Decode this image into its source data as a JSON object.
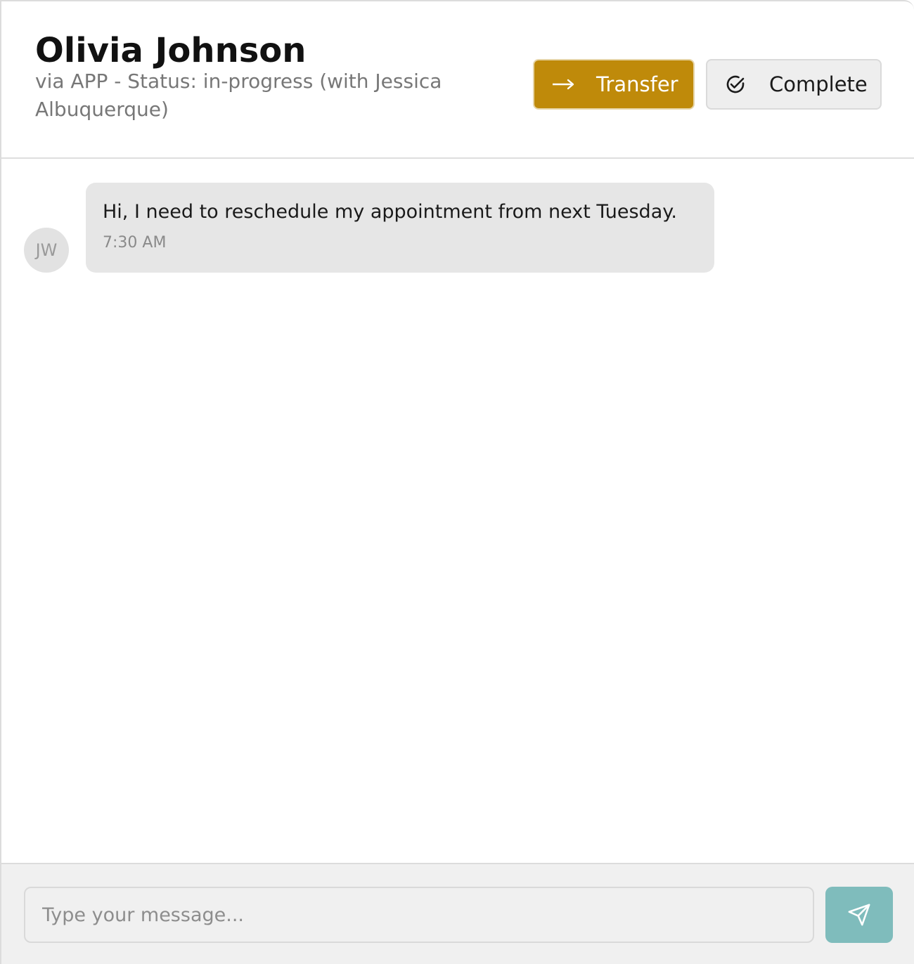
{
  "header": {
    "title": "Olivia Johnson",
    "subtitle": "via APP - Status: in-progress (with Jessica Albuquerque)",
    "transfer_label": "Transfer",
    "complete_label": "Complete",
    "transfer_icon": "arrow-right-icon",
    "complete_icon": "check-circle-icon"
  },
  "messages": [
    {
      "avatar_initials": "JW",
      "text": "Hi, I need to reschedule my appointment from next Tuesday.",
      "time": "7:30 AM"
    }
  ],
  "composer": {
    "placeholder": "Type your message...",
    "send_icon": "send-icon"
  },
  "colors": {
    "transfer": "#bf8a0a",
    "send": "#7fbcbc",
    "bubble": "#e6e6e6"
  }
}
